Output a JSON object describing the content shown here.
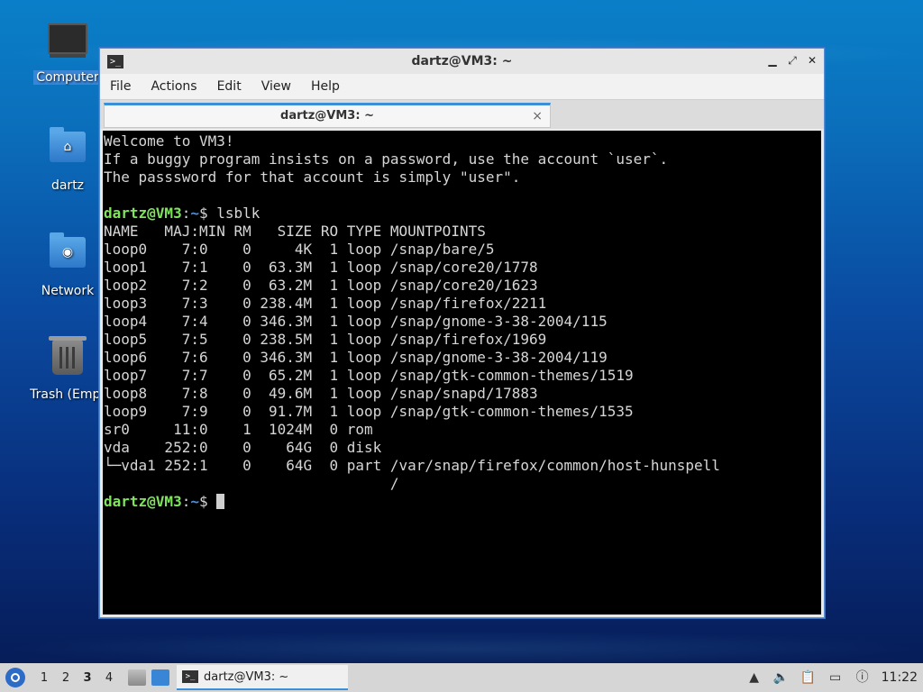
{
  "desktop": {
    "icons": [
      {
        "label": "Computer",
        "icon": "computer-icon"
      },
      {
        "label": "dartz",
        "icon": "home-folder-icon"
      },
      {
        "label": "Network",
        "icon": "network-folder-icon"
      },
      {
        "label": "Trash (Empt",
        "icon": "trash-icon"
      }
    ]
  },
  "window": {
    "title": "dartz@VM3: ~",
    "menu": [
      "File",
      "Actions",
      "Edit",
      "View",
      "Help"
    ],
    "tab_title": "dartz@VM3: ~",
    "tab_close": "×"
  },
  "terminal": {
    "motd": [
      "Welcome to VM3!",
      "If a buggy program insists on a password, use the account `user`.",
      "The passsword for that account is simply \"user\"."
    ],
    "prompt_user": "dartz@VM3",
    "prompt_sep": ":",
    "prompt_path": "~",
    "prompt_symbol": "$ ",
    "command": "lsblk",
    "output": [
      "NAME   MAJ:MIN RM   SIZE RO TYPE MOUNTPOINTS",
      "loop0    7:0    0     4K  1 loop /snap/bare/5",
      "loop1    7:1    0  63.3M  1 loop /snap/core20/1778",
      "loop2    7:2    0  63.2M  1 loop /snap/core20/1623",
      "loop3    7:3    0 238.4M  1 loop /snap/firefox/2211",
      "loop4    7:4    0 346.3M  1 loop /snap/gnome-3-38-2004/115",
      "loop5    7:5    0 238.5M  1 loop /snap/firefox/1969",
      "loop6    7:6    0 346.3M  1 loop /snap/gnome-3-38-2004/119",
      "loop7    7:7    0  65.2M  1 loop /snap/gtk-common-themes/1519",
      "loop8    7:8    0  49.6M  1 loop /snap/snapd/17883",
      "loop9    7:9    0  91.7M  1 loop /snap/gtk-common-themes/1535",
      "sr0     11:0    1  1024M  0 rom",
      "vda    252:0    0    64G  0 disk",
      "└─vda1 252:1    0    64G  0 part /var/snap/firefox/common/host-hunspell",
      "                                 /"
    ]
  },
  "taskbar": {
    "workspaces": [
      "1",
      "2",
      "3",
      "4"
    ],
    "active_workspace": "3",
    "task_label": "dartz@VM3: ~",
    "clock": "11:22"
  }
}
